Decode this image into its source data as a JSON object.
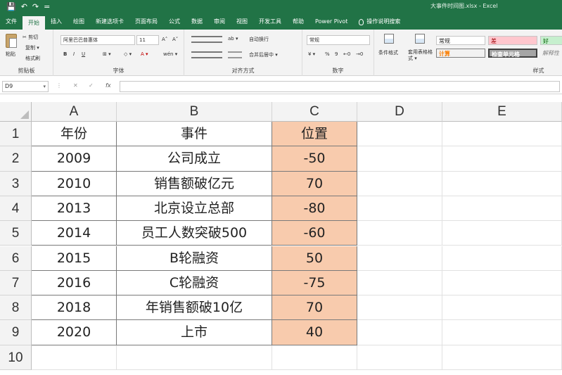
{
  "window": {
    "title": "大事件时间图.xlsx - Excel",
    "qat": [
      "💾",
      "↶",
      "↷",
      "="
    ]
  },
  "tabs": [
    {
      "label": "文件"
    },
    {
      "label": "开始"
    },
    {
      "label": "插入"
    },
    {
      "label": "绘图"
    },
    {
      "label": "新建选项卡"
    },
    {
      "label": "页面布局"
    },
    {
      "label": "公式"
    },
    {
      "label": "数据"
    },
    {
      "label": "审阅"
    },
    {
      "label": "视图"
    },
    {
      "label": "开发工具"
    },
    {
      "label": "帮助"
    },
    {
      "label": "Power Pivot"
    },
    {
      "label": "操作说明搜索"
    }
  ],
  "ribbon": {
    "clipboard": {
      "label": "剪贴板",
      "paste": "粘贴",
      "cut": "✂ 剪切",
      "copy": "复制 ▾",
      "format_painter": "格式刷"
    },
    "font": {
      "label": "字体",
      "font_name": "阿里巴巴普惠体",
      "font_size": "11",
      "bold": "B",
      "italic": "I",
      "underline": "U",
      "grow": "A˄",
      "shrink": "A˅",
      "border": "⊞ ▾",
      "fill": "◇ ▾",
      "color": "A ▾",
      "phonetic": "wén ▾"
    },
    "alignment": {
      "label": "对齐方式",
      "wrap": "自动换行",
      "merge": "合并后居中 ▾",
      "orient": "ab ▾"
    },
    "number": {
      "label": "数字",
      "format": "常规",
      "currency": "¥ ▾",
      "percent": "%",
      "comma": "9",
      "inc": "←0",
      "dec": "→0"
    },
    "styles": {
      "label": "样式",
      "cond_format": "条件格式",
      "table_format": "套用表格格式 ▾",
      "normal": "常规",
      "bad": "差",
      "good": "好",
      "calc": "计算",
      "check_cell": "检查单元格",
      "explain": "解释性"
    }
  },
  "formula_bar": {
    "name_box": "D9",
    "name_dropdown": "▾",
    "dots": "⋮",
    "cancel": "✕",
    "confirm": "✓",
    "fx": "fx",
    "value": ""
  },
  "sheet": {
    "columns": [
      "A",
      "B",
      "C",
      "D",
      "E"
    ],
    "rows": [
      "1",
      "2",
      "3",
      "4",
      "5",
      "6",
      "7",
      "8",
      "9",
      "10"
    ],
    "header": [
      "年份",
      "事件",
      "位置"
    ],
    "data": [
      [
        "2009",
        "公司成立",
        "-50"
      ],
      [
        "2010",
        "销售额破亿元",
        "70"
      ],
      [
        "2013",
        "北京设立总部",
        "-80"
      ],
      [
        "2014",
        "员工人数突破500",
        "-60"
      ],
      [
        "2015",
        "B轮融资",
        "50"
      ],
      [
        "2016",
        "C轮融资",
        "-75"
      ],
      [
        "2018",
        "年销售额破10亿",
        "70"
      ],
      [
        "2020",
        "上市",
        "40"
      ]
    ],
    "highlight_color": "#f8cbad",
    "accent_color": "#217346"
  }
}
